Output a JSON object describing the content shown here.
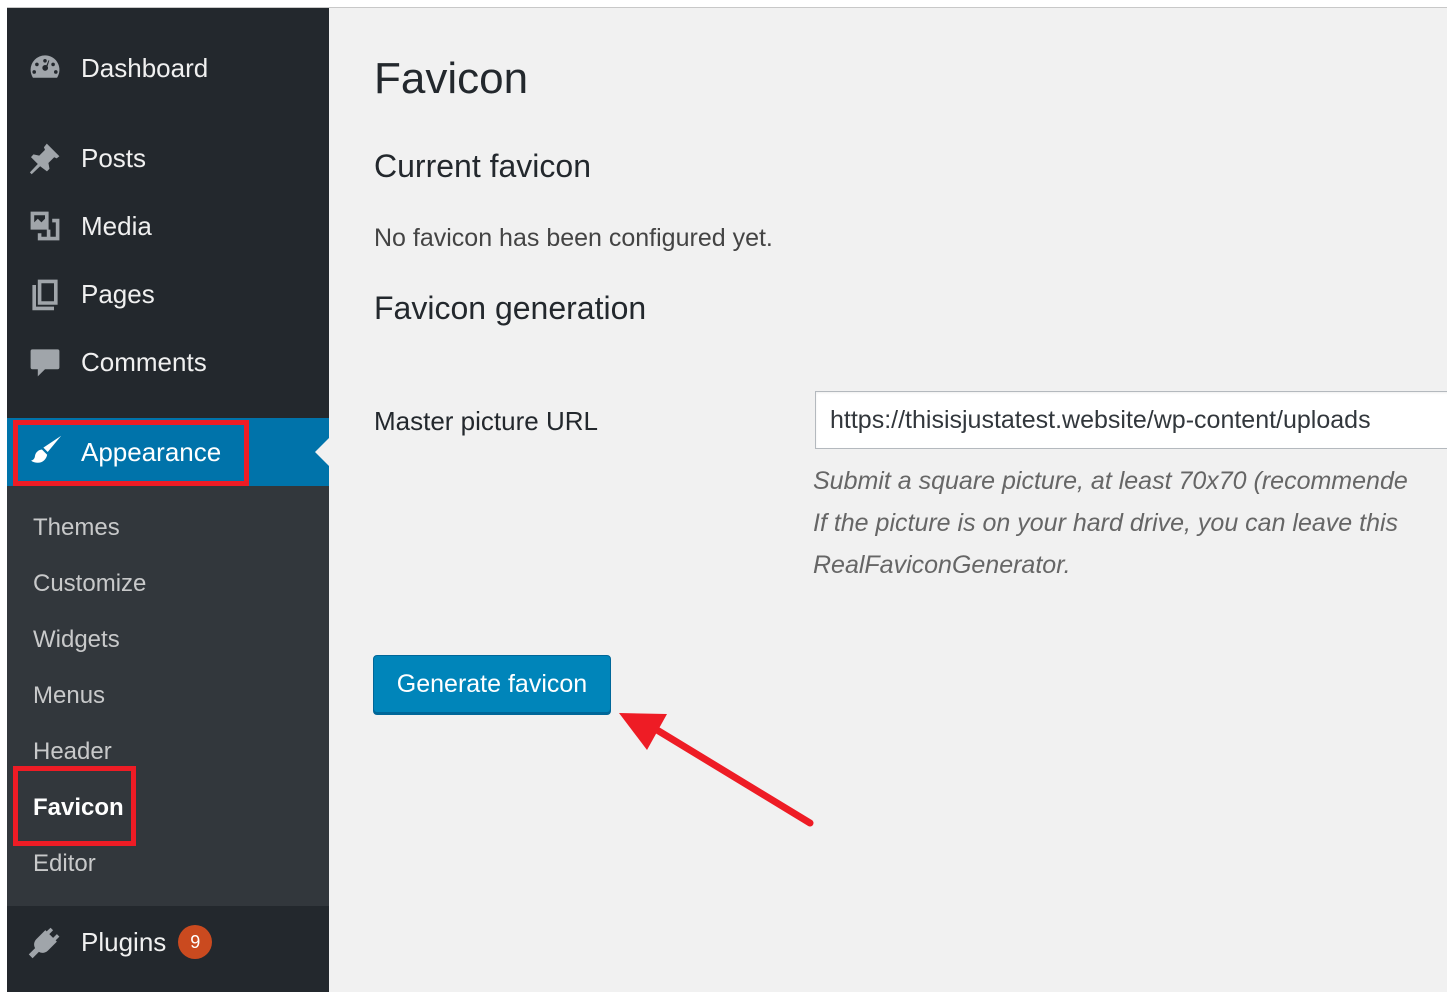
{
  "sidebar": {
    "items": [
      {
        "key": "dashboard",
        "label": "Dashboard",
        "icon": "dashboard-icon"
      },
      {
        "key": "posts",
        "label": "Posts",
        "icon": "pin-icon"
      },
      {
        "key": "media",
        "label": "Media",
        "icon": "media-icon"
      },
      {
        "key": "pages",
        "label": "Pages",
        "icon": "pages-icon"
      },
      {
        "key": "comments",
        "label": "Comments",
        "icon": "comment-icon"
      },
      {
        "key": "appearance",
        "label": "Appearance",
        "icon": "paintbrush-icon"
      },
      {
        "key": "plugins",
        "label": "Plugins",
        "icon": "plug-icon",
        "badge": "9"
      }
    ],
    "submenu": [
      "Themes",
      "Customize",
      "Widgets",
      "Menus",
      "Header",
      "Favicon",
      "Editor"
    ],
    "active_item": "Appearance",
    "active_submenu": "Favicon"
  },
  "main": {
    "title": "Favicon",
    "current_heading": "Current favicon",
    "current_status": "No favicon has been configured yet.",
    "generation_heading": "Favicon generation",
    "master_label": "Master picture URL",
    "master_value": "https://thisisjustatest.website/wp-content/uploads",
    "description_lines": [
      "Submit a square picture, at least 70x70 (recommende",
      "If the picture is on your hard drive, you can leave this",
      "RealFaviconGenerator."
    ],
    "button_label": "Generate favicon"
  },
  "colors": {
    "sidebar_bg": "#23282d",
    "submenu_bg": "#32373c",
    "accent": "#0073aa",
    "button": "#0085ba",
    "highlight": "#ee1c25",
    "badge": "#ca4a1f"
  }
}
